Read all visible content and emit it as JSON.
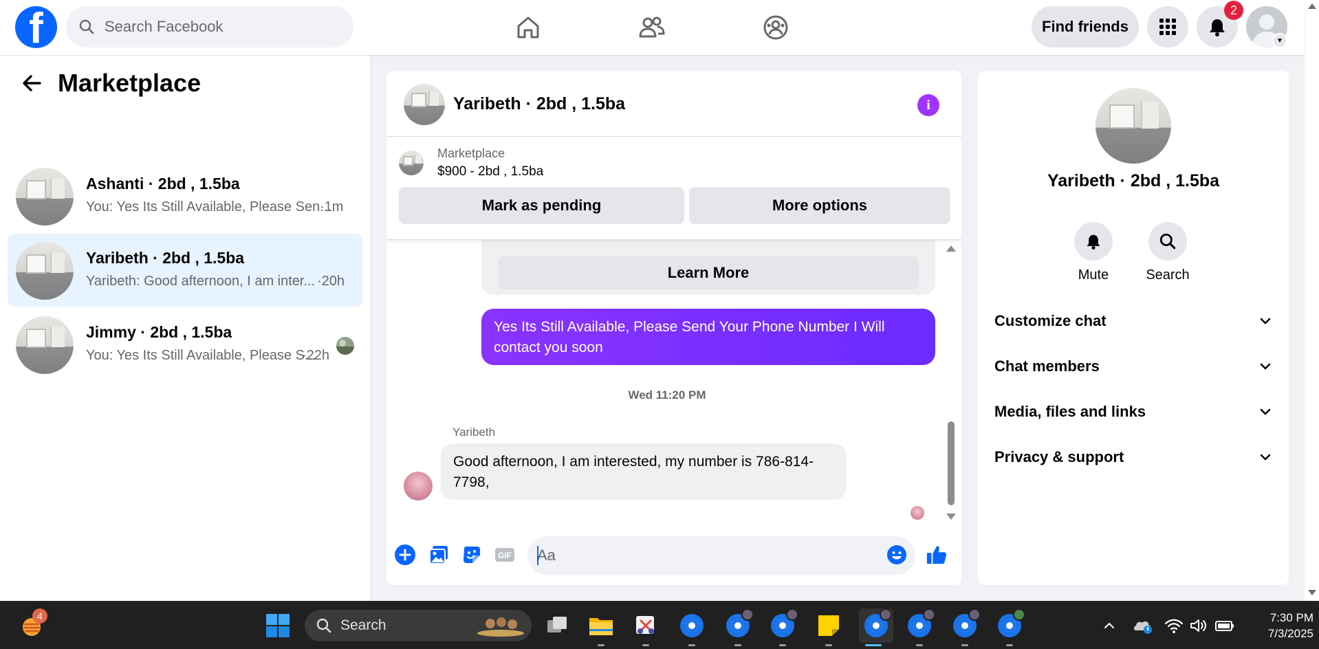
{
  "topbar": {
    "logo": "f",
    "search_placeholder": "Search Facebook",
    "find_friends": "Find friends",
    "notification_count": "2",
    "icons": [
      "home-icon",
      "friends-icon",
      "groups-icon",
      "menu-grid-icon",
      "bell-icon",
      "profile-avatar"
    ]
  },
  "sidebar": {
    "title": "Marketplace",
    "conversations": [
      {
        "name": "Ashanti · 2bd , 1.5ba",
        "preview": "You: Yes Its Still Available, Please Sen...",
        "time": "·1m",
        "active": false
      },
      {
        "name": "Yaribeth · 2bd , 1.5ba",
        "preview": "Yaribeth: Good afternoon, I am inter...",
        "time": "·20h",
        "active": true
      },
      {
        "name": "Jimmy · 2bd , 1.5ba",
        "preview": "You: Yes Its Still Available, Please S...",
        "time": "·22h",
        "active": false
      }
    ]
  },
  "chat": {
    "title": "Yaribeth · 2bd , 1.5ba",
    "listing": {
      "source": "Marketplace",
      "price_line": "$900 - 2bd , 1.5ba",
      "mark_pending": "Mark as pending",
      "more_options": "More options"
    },
    "messages": {
      "learn_more": "Learn More",
      "outgoing": "Yes Its Still Available, Please Send Your Phone Number I Will contact you soon",
      "timestamp": "Wed 11:20 PM",
      "sender": "Yaribeth",
      "incoming": "Good afternoon, I am interested, my number is 786-814-7798,"
    },
    "composer": {
      "placeholder": "Aa",
      "gif_label": "GIF"
    }
  },
  "details": {
    "title": "Yaribeth · 2bd , 1.5ba",
    "actions": [
      {
        "label": "Mute",
        "icon": "bell-icon"
      },
      {
        "label": "Search",
        "icon": "search-icon"
      }
    ],
    "sections": [
      "Customize chat",
      "Chat members",
      "Media, files and links",
      "Privacy & support"
    ]
  },
  "taskbar": {
    "widget_badge": "4",
    "search_label": "Search",
    "time": "7:30 PM",
    "date": "7/3/2025"
  },
  "colors": {
    "facebook_blue": "#0866ff",
    "messenger_purple": "#7b2fff",
    "notification_red": "#e41e3f",
    "active_conversation": "#e7f3ff"
  }
}
